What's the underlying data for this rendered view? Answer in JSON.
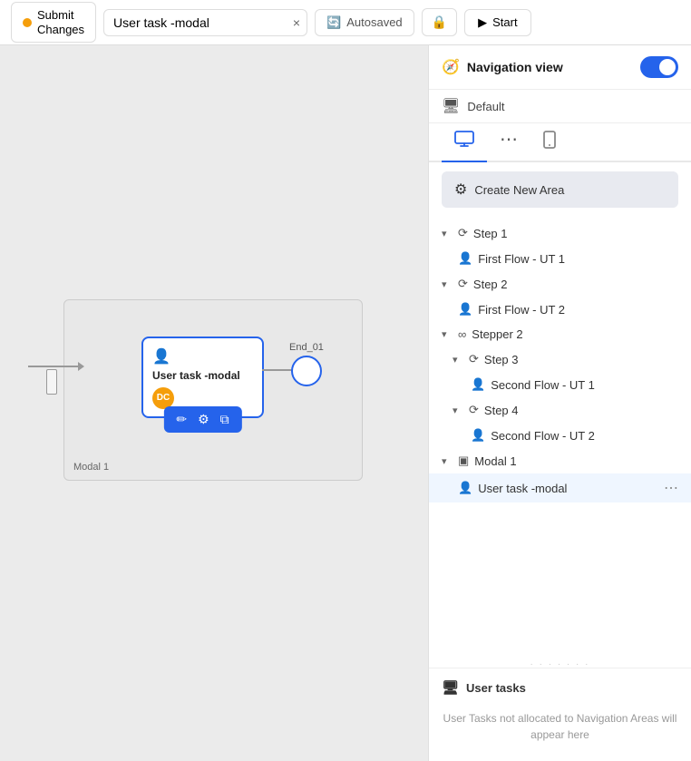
{
  "toolbar": {
    "submit_label": "Submit\nChanges",
    "title_value": "User task -modal",
    "clear_icon": "×",
    "autosaved_label": "Autosaved",
    "start_label": "Start"
  },
  "canvas": {
    "modal_label": "Modal 1",
    "task_title": "User task -modal",
    "task_badge": "DC",
    "end_label": "End_01",
    "toolbar_icons": [
      "✏",
      "⚙",
      "⧉"
    ]
  },
  "panel": {
    "nav_toggle_label": "Navigation view",
    "default_label": "Default",
    "tabs": [
      {
        "id": "desktop",
        "icon": "🖥",
        "active": true
      },
      {
        "id": "more",
        "icon": "⋯",
        "active": false
      },
      {
        "id": "mobile",
        "icon": "📱",
        "active": false
      }
    ],
    "create_area_label": "Create New Area",
    "tree": [
      {
        "label": "Step 1",
        "type": "step",
        "depth": 0,
        "expanded": true
      },
      {
        "label": "First Flow - UT 1",
        "type": "user",
        "depth": 1
      },
      {
        "label": "Step 2",
        "type": "step",
        "depth": 0,
        "expanded": true
      },
      {
        "label": "First Flow - UT 2",
        "type": "user",
        "depth": 1
      },
      {
        "label": "Stepper 2",
        "type": "stepper",
        "depth": 0,
        "expanded": true
      },
      {
        "label": "Step 3",
        "type": "step",
        "depth": 1,
        "expanded": true
      },
      {
        "label": "Second Flow - UT 1",
        "type": "user",
        "depth": 2
      },
      {
        "label": "Step 4",
        "type": "step",
        "depth": 1,
        "expanded": true
      },
      {
        "label": "Second Flow - UT 2",
        "type": "user",
        "depth": 2
      },
      {
        "label": "Modal 1",
        "type": "modal",
        "depth": 0,
        "expanded": true
      },
      {
        "label": "User task -modal",
        "type": "user",
        "depth": 1,
        "active": true
      }
    ],
    "user_tasks_label": "User tasks",
    "user_tasks_empty": "User Tasks not allocated to Navigation\nAreas will appear here"
  }
}
